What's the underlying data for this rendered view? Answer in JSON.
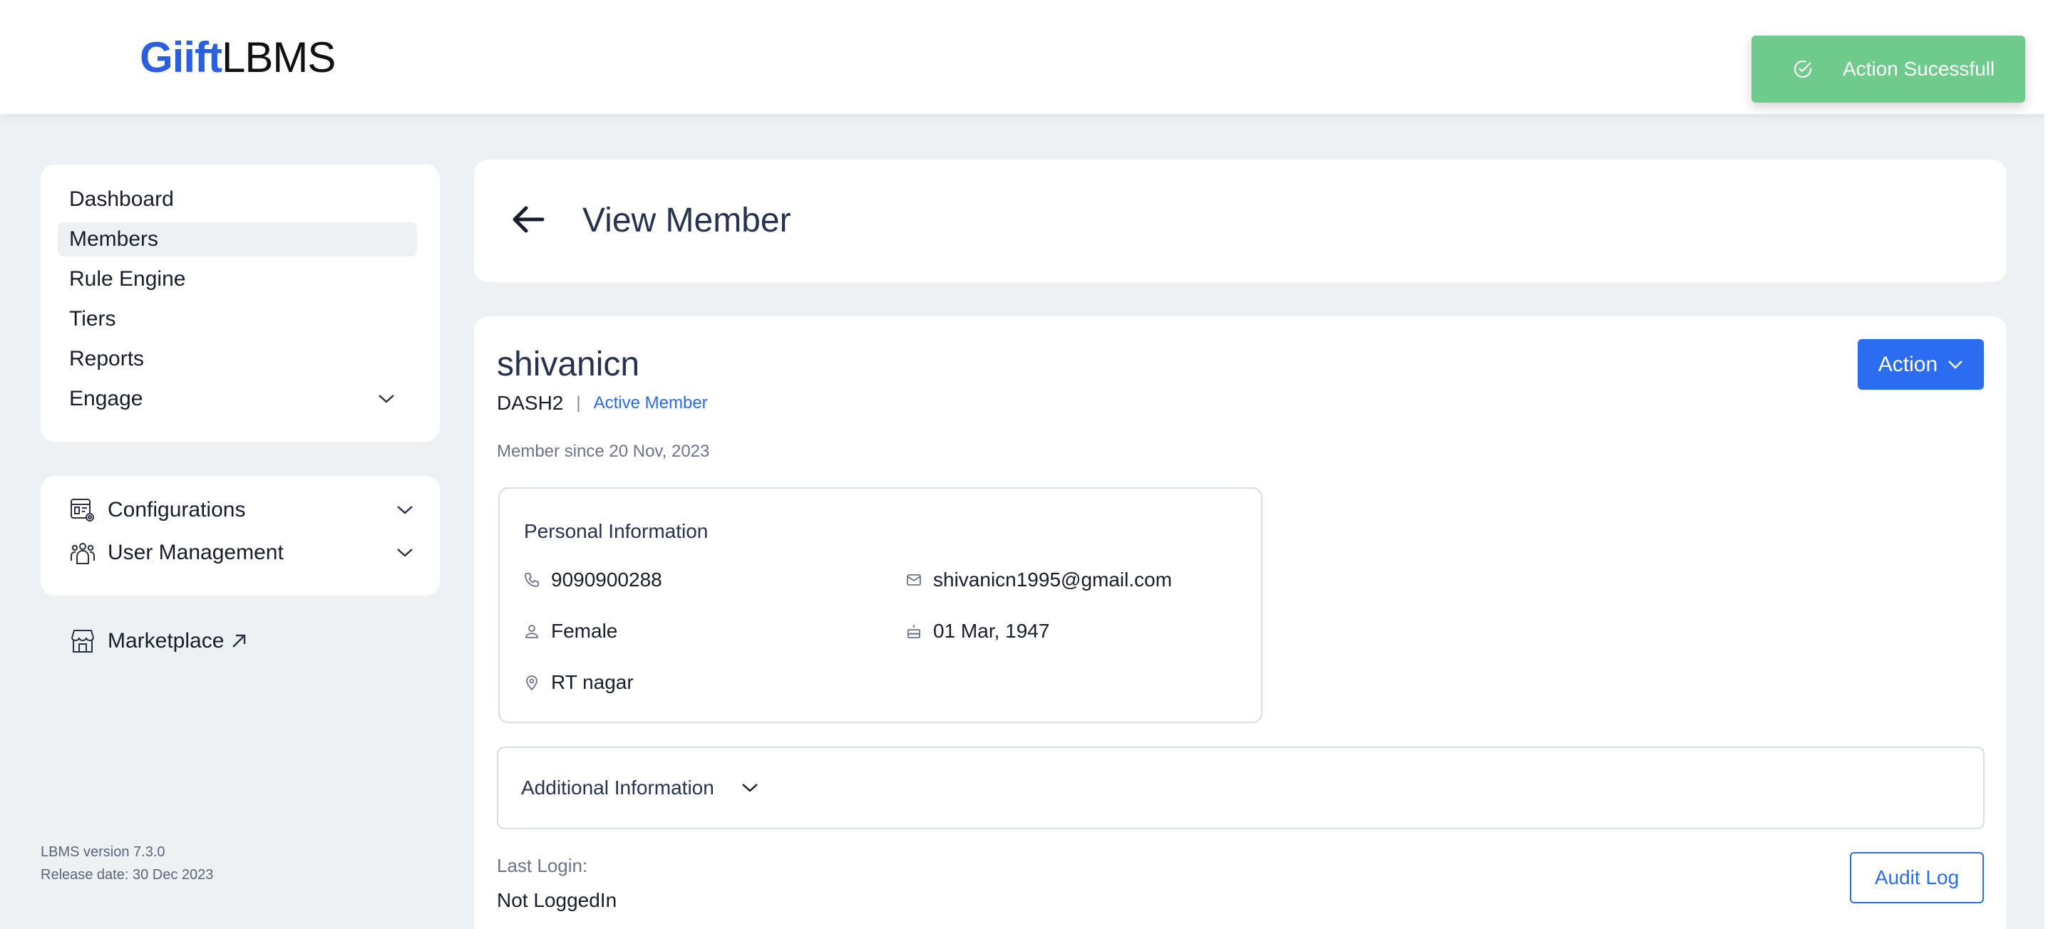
{
  "app": {
    "logo_part1": "Giift",
    "logo_part2": "LBMS"
  },
  "toast": {
    "message": "Action Sucessfull",
    "color": "#6fcb8c"
  },
  "sidebar": {
    "items": [
      {
        "label": "Dashboard",
        "active": false
      },
      {
        "label": "Members",
        "active": true
      },
      {
        "label": "Rule Engine",
        "active": false
      },
      {
        "label": "Tiers",
        "active": false
      },
      {
        "label": "Reports",
        "active": false
      },
      {
        "label": "Engage",
        "active": false,
        "expandable": true
      }
    ],
    "settings": [
      {
        "label": "Configurations",
        "icon": "configurations-icon"
      },
      {
        "label": "User Management",
        "icon": "user-management-icon"
      }
    ],
    "marketplace_label": "Marketplace",
    "version": "LBMS version 7.3.0",
    "release": "Release date: 30 Dec 2023"
  },
  "header": {
    "title": "View Member"
  },
  "member": {
    "name": "shivanicn",
    "code": "DASH2",
    "separator": "|",
    "status": "Active Member",
    "since": "Member since 20 Nov, 2023",
    "action_label": "Action",
    "personal": {
      "title": "Personal Information",
      "phone": "9090900288",
      "email": "shivanicn1995@gmail.com",
      "gender": "Female",
      "dob": "01 Mar, 1947",
      "location": "RT nagar"
    },
    "additional_label": "Additional Information",
    "last_login_label": "Last Login:",
    "last_login_value": "Not LoggedIn",
    "audit_label": "Audit Log"
  },
  "colors": {
    "accent": "#2c6cf0",
    "title_text": "#26324f",
    "page_bg": "#edf1f4"
  }
}
